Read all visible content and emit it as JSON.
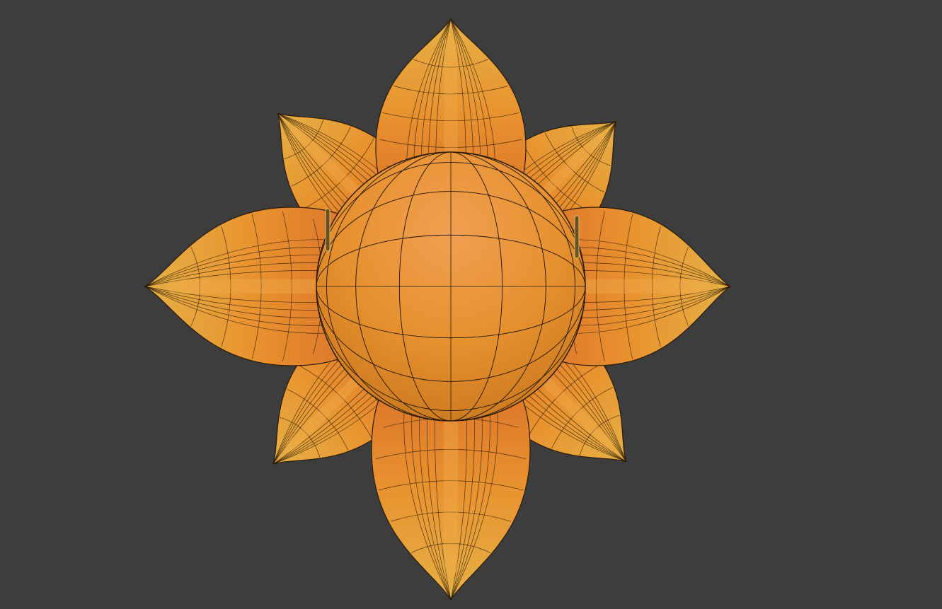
{
  "viewport": {
    "background_color": "#3d3d3d",
    "object": "flower-mesh",
    "colors": {
      "petal_light": "#e0a43a",
      "petal_mid": "#e0872f",
      "petal_dark": "#b8581c",
      "sphere_light": "#f0a050",
      "sphere_dark": "#c85a22",
      "wire": "#2a1a08"
    }
  }
}
